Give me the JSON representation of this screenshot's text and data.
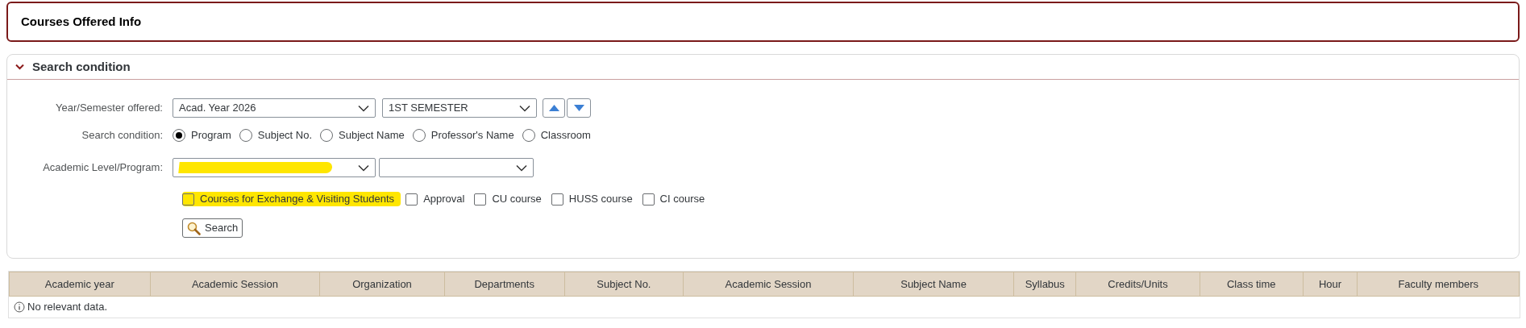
{
  "page_title": "Courses Offered Info",
  "search_panel": {
    "title": "Search condition",
    "expanded": true,
    "year_semester": {
      "label": "Year/Semester offered:",
      "year": "Acad. Year 2026",
      "semester": "1ST SEMESTER"
    },
    "condition": {
      "label": "Search condition:",
      "options": [
        {
          "label": "Program",
          "selected": true
        },
        {
          "label": "Subject No.",
          "selected": false
        },
        {
          "label": "Subject Name",
          "selected": false
        },
        {
          "label": "Professor's Name",
          "selected": false
        },
        {
          "label": "Classroom",
          "selected": false
        }
      ]
    },
    "program": {
      "label": "Academic Level/Program:",
      "level_redacted": true
    },
    "checkboxes": [
      {
        "label": "Courses for Exchange & Visiting Students",
        "checked": false,
        "highlighted": true
      },
      {
        "label": "Approval",
        "checked": false,
        "highlighted": false
      },
      {
        "label": "CU course",
        "checked": false,
        "highlighted": false
      },
      {
        "label": "HUSS course",
        "checked": false,
        "highlighted": false
      },
      {
        "label": "CI course",
        "checked": false,
        "highlighted": false
      }
    ],
    "search_button": "Search"
  },
  "table": {
    "columns": [
      "Academic year",
      "Academic Session",
      "Organization",
      "Departments",
      "Subject No.",
      "Academic Session",
      "Subject Name",
      "Syllabus",
      "Credits/Units",
      "Class time",
      "Hour",
      "Faculty members"
    ],
    "empty_message": "No relevant data."
  }
}
